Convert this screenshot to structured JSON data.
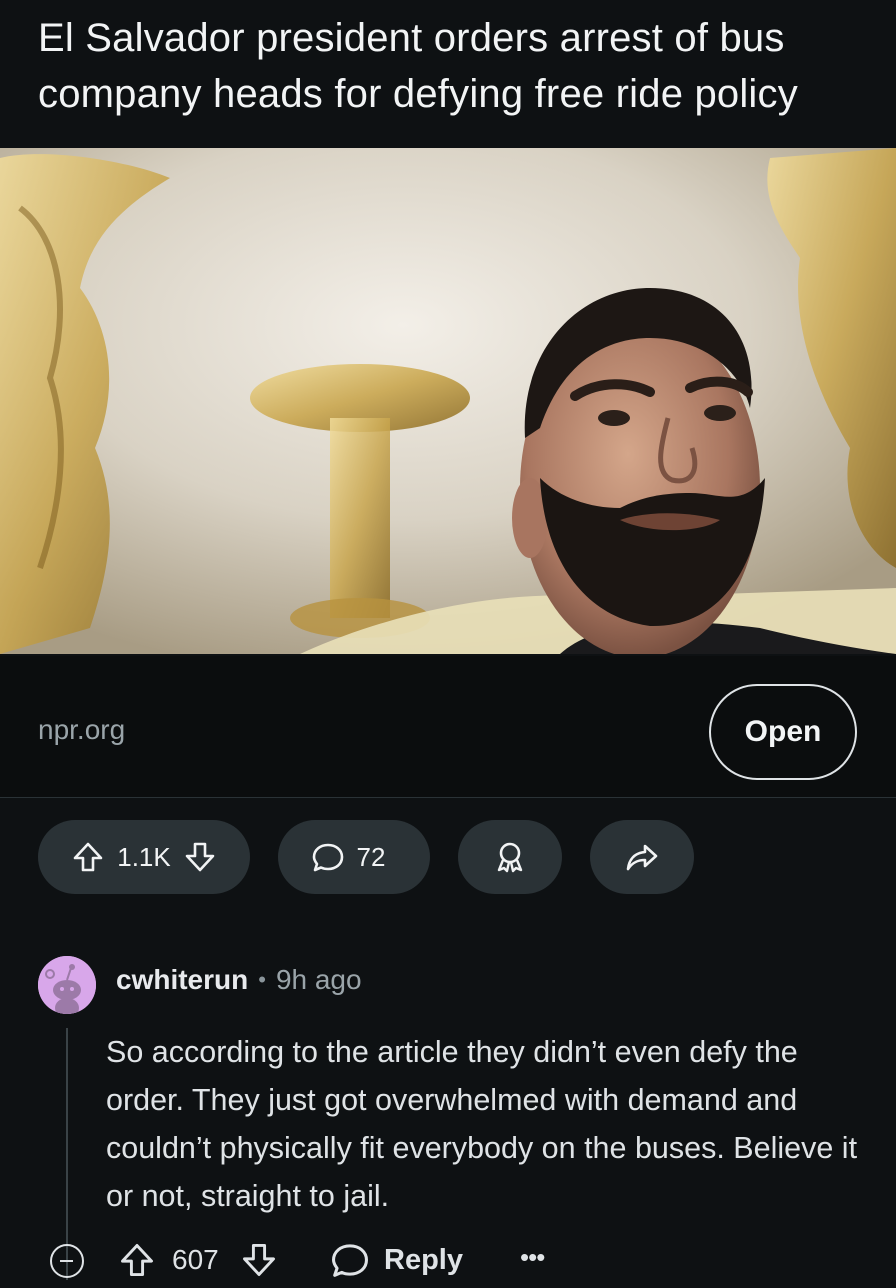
{
  "post": {
    "title": "El Salvador president orders arrest of bus company heads for defying free ride policy",
    "domain": "npr.org",
    "open_label": "Open"
  },
  "actions": {
    "score": "1.1K",
    "comments": "72"
  },
  "comment": {
    "username": "cwhiterun",
    "separator": "•",
    "time": "9h ago",
    "body": "So according to the article they didn’t even defy the order. They just got overwhelmed with demand and couldn’t physically fit everybody on the buses. Believe it or not, straight to jail.",
    "score": "607",
    "reply_label": "Reply",
    "more_label": "•••"
  },
  "icons": {
    "upvote": "arrow-up-icon",
    "downvote": "arrow-down-icon",
    "comment": "speech-bubble-icon",
    "award": "award-icon",
    "share": "share-arrow-icon",
    "collapse": "minus-circle-icon",
    "more": "more-dots-icon"
  },
  "colors": {
    "background": "#0e1113",
    "pill": "#2a3236",
    "avatar": "#d8a7ea"
  }
}
